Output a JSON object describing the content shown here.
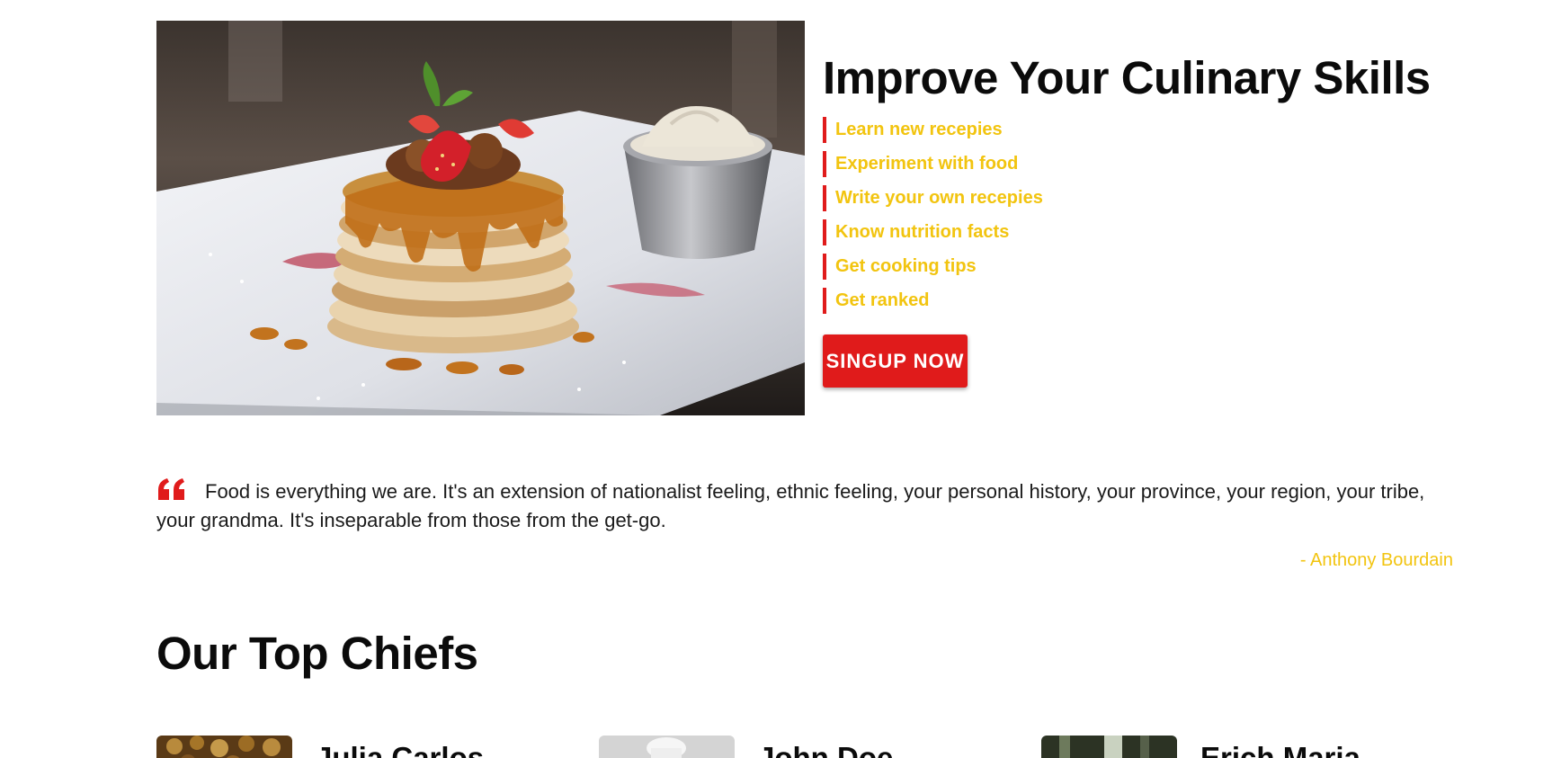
{
  "hero": {
    "title": "Improve Your Culinary Skills",
    "features": [
      "Learn new recepies",
      "Experiment with food",
      "Write your own recepies",
      "Know nutrition facts",
      "Get cooking tips",
      "Get ranked"
    ],
    "signup_label": "SINGUP NOW"
  },
  "quote": {
    "text": "Food is everything we are. It's an extension of nationalist feeling, ethnic feeling, your personal history, your province, your region, your tribe, your grandma. It's inseparable from those from the get-go.",
    "author": "- Anthony Bourdain"
  },
  "chiefs": {
    "title": "Our Top Chiefs",
    "items": [
      {
        "name": "Julia Carlos"
      },
      {
        "name": "John Doe"
      },
      {
        "name": "Erich Maria"
      }
    ]
  },
  "colors": {
    "accent_red": "#e01b1b",
    "accent_yellow": "#f2c40f",
    "text_dark": "#0b0b0b"
  }
}
